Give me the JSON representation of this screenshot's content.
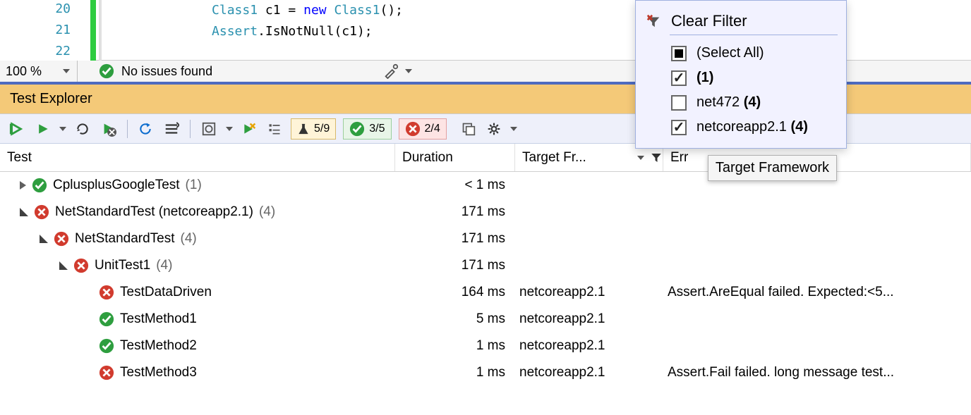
{
  "editor": {
    "lines": {
      "n20": "20",
      "n21": "21",
      "n22": "22"
    },
    "code": {
      "l1_type1": "Class1",
      "l1_var": " c1 = ",
      "l1_kw": "new",
      "l1_type2": " Class1",
      "l1_end": "();",
      "l2_a": "Assert",
      "l2_b": ".IsNotNull(c1);"
    },
    "indent": "                        ",
    "indent2": "                        "
  },
  "status": {
    "zoom": "100 %",
    "issues": "No issues found"
  },
  "te": {
    "title": "Test Explorer",
    "counters": {
      "flask": "5/9",
      "pass": "3/5",
      "fail": "2/4"
    },
    "columns": {
      "test": "Test",
      "duration": "Duration",
      "target": "Target Fr...",
      "error": "Err"
    },
    "rows": [
      {
        "lvl": 0,
        "exp": "r",
        "status": "pass",
        "name": "CplusplusGoogleTest",
        "count": "(1)",
        "dur": "< 1 ms",
        "tf": "",
        "err": ""
      },
      {
        "lvl": 0,
        "exp": "d",
        "status": "fail",
        "name": "NetStandardTest (netcoreapp2.1)",
        "count": "(4)",
        "dur": "171 ms",
        "tf": "",
        "err": ""
      },
      {
        "lvl": 1,
        "exp": "d",
        "status": "fail",
        "name": "NetStandardTest",
        "count": "(4)",
        "dur": "171 ms",
        "tf": "",
        "err": ""
      },
      {
        "lvl": 2,
        "exp": "d",
        "status": "fail",
        "name": "UnitTest1",
        "count": "(4)",
        "dur": "171 ms",
        "tf": "",
        "err": ""
      },
      {
        "lvl": 3,
        "exp": "",
        "status": "fail",
        "name": "TestDataDriven",
        "count": "",
        "dur": "164 ms",
        "tf": "netcoreapp2.1",
        "err": "Assert.AreEqual failed. Expected:<5..."
      },
      {
        "lvl": 3,
        "exp": "",
        "status": "pass",
        "name": "TestMethod1",
        "count": "",
        "dur": "5 ms",
        "tf": "netcoreapp2.1",
        "err": ""
      },
      {
        "lvl": 3,
        "exp": "",
        "status": "pass",
        "name": "TestMethod2",
        "count": "",
        "dur": "1 ms",
        "tf": "netcoreapp2.1",
        "err": ""
      },
      {
        "lvl": 3,
        "exp": "",
        "status": "fail",
        "name": "TestMethod3",
        "count": "",
        "dur": "1 ms",
        "tf": "netcoreapp2.1",
        "err": "Assert.Fail failed. long message test..."
      }
    ]
  },
  "popup": {
    "clear": "Clear Filter",
    "items": [
      {
        "state": "square",
        "label": "(Select All)",
        "bold": ""
      },
      {
        "state": "check",
        "label": "<blank> ",
        "bold": "(1)"
      },
      {
        "state": "none",
        "label": "net472 ",
        "bold": "(4)"
      },
      {
        "state": "check",
        "label": "netcoreapp2.1 ",
        "bold": "(4)"
      }
    ]
  },
  "tooltip": "Target Framework"
}
